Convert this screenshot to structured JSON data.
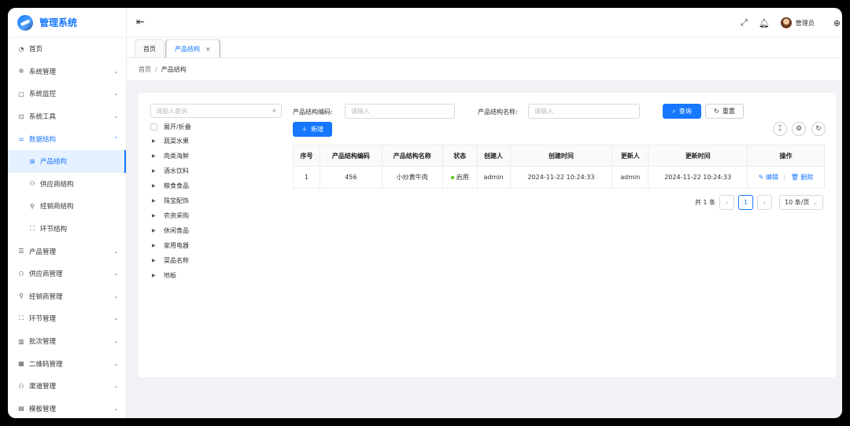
{
  "app": {
    "title": "管理系统"
  },
  "sidebar": {
    "items": [
      {
        "label": "首页",
        "icon": "dashboard-icon",
        "glyph": "◔",
        "arrow": ""
      },
      {
        "label": "系统管理",
        "icon": "gear-icon",
        "glyph": "✲",
        "arrow": "⌄"
      },
      {
        "label": "系统监控",
        "icon": "monitor-icon",
        "glyph": "▢",
        "arrow": "⌄"
      },
      {
        "label": "系统工具",
        "icon": "toolbox-icon",
        "glyph": "⊡",
        "arrow": "⌄"
      },
      {
        "label": "数据结构",
        "icon": "structure-icon",
        "glyph": "⚌",
        "arrow": "⌃"
      },
      {
        "label": "产品结构",
        "icon": "product-structure-icon",
        "glyph": "⊞",
        "arrow": ""
      },
      {
        "label": "供应商结构",
        "icon": "supplier-structure-icon",
        "glyph": "⚇",
        "arrow": ""
      },
      {
        "label": "经销商结构",
        "icon": "dealer-structure-icon",
        "glyph": "⚲",
        "arrow": ""
      },
      {
        "label": "环节结构",
        "icon": "link-structure-icon",
        "glyph": "⛶",
        "arrow": ""
      },
      {
        "label": "产品管理",
        "icon": "list-icon",
        "glyph": "☰",
        "arrow": "⌄"
      },
      {
        "label": "供应商管理",
        "icon": "supplier-icon",
        "glyph": "⚇",
        "arrow": "⌄"
      },
      {
        "label": "经销商管理",
        "icon": "dealer-icon",
        "glyph": "⚲",
        "arrow": "⌄"
      },
      {
        "label": "环节管理",
        "icon": "link-icon",
        "glyph": "⛶",
        "arrow": "⌄"
      },
      {
        "label": "批次管理",
        "icon": "barcode-icon",
        "glyph": "▥",
        "arrow": "⌄"
      },
      {
        "label": "二维码管理",
        "icon": "qrcode-icon",
        "glyph": "▦",
        "arrow": "⌄"
      },
      {
        "label": "渠道管理",
        "icon": "channel-icon",
        "glyph": "⚇",
        "arrow": "⌄"
      },
      {
        "label": "模板管理",
        "icon": "template-icon",
        "glyph": "▤",
        "arrow": "⌄"
      }
    ]
  },
  "header": {
    "user": "管理员"
  },
  "tabs": [
    {
      "label": "首页"
    },
    {
      "label": "产品结构",
      "close": "×"
    }
  ],
  "breadcrumb": {
    "home": "首页",
    "sep": "/",
    "current": "产品结构"
  },
  "tree": {
    "search_placeholder": "请输入查询",
    "expand_label": "展开/折叠",
    "nodes": [
      "蔬菜水果",
      "肉类海鲜",
      "酒水饮料",
      "粮食食品",
      "珠宝配饰",
      "农资采购",
      "休闲食品",
      "家用电器",
      "菜品名称",
      "地板"
    ]
  },
  "filters": {
    "code_label": "产品结构编码:",
    "code_placeholder": "请输入",
    "name_label": "产品结构名称:",
    "name_placeholder": "请输入",
    "search_btn": "查询",
    "reset_btn": "重置",
    "add_btn": "新增"
  },
  "table": {
    "columns": [
      "序号",
      "产品结构编码",
      "产品结构名称",
      "状态",
      "创建人",
      "创建时间",
      "更新人",
      "更新时间",
      "操作"
    ],
    "rows": [
      {
        "index": "1",
        "code": "456",
        "name": "小炒黄牛肉",
        "status": "启用",
        "creator": "admin",
        "created_at": "2024-11-22 10:24:33",
        "updater": "admin",
        "updated_at": "2024-11-22 10:24:33",
        "edit": "编辑",
        "delete": "删除"
      }
    ]
  },
  "pagination": {
    "total": "共 1 条",
    "current": "1",
    "page_size": "10 条/页"
  },
  "colors": {
    "primary": "#1677ff",
    "status_active": "#52c41a",
    "menu_active_bg": "#e6f1ff"
  }
}
